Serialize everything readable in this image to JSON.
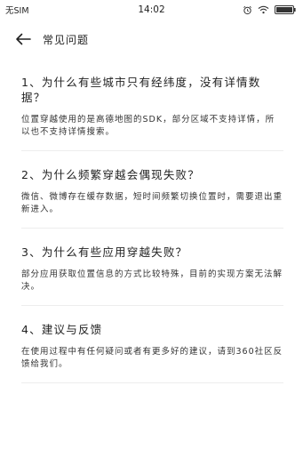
{
  "status_bar": {
    "sim": "无SIM",
    "time": "14:02",
    "icons": [
      "alarm-icon",
      "wifi-icon",
      "battery-icon"
    ]
  },
  "app_bar": {
    "back_icon": "arrow-left-icon",
    "title": "常见问题"
  },
  "faq": [
    {
      "question": "1、为什么有些城市只有经纬度，没有详情数据？",
      "answer": "位置穿越使用的是高德地图的SDK，部分区域不支持详情，所以也不支持详情搜索。"
    },
    {
      "question": "2、为什么频繁穿越会偶现失败？",
      "answer": "微信、微博存在缓存数据，短时间频繁切换位置时，需要退出重新进入。"
    },
    {
      "question": "3、为什么有些应用穿越失败？",
      "answer": "部分应用获取位置信息的方式比较特殊，目前的实现方案无法解决。"
    },
    {
      "question": "4、建议与反馈",
      "answer": "在使用过程中有任何疑问或者有更多好的建议，请到360社区反馈给我们。"
    }
  ]
}
